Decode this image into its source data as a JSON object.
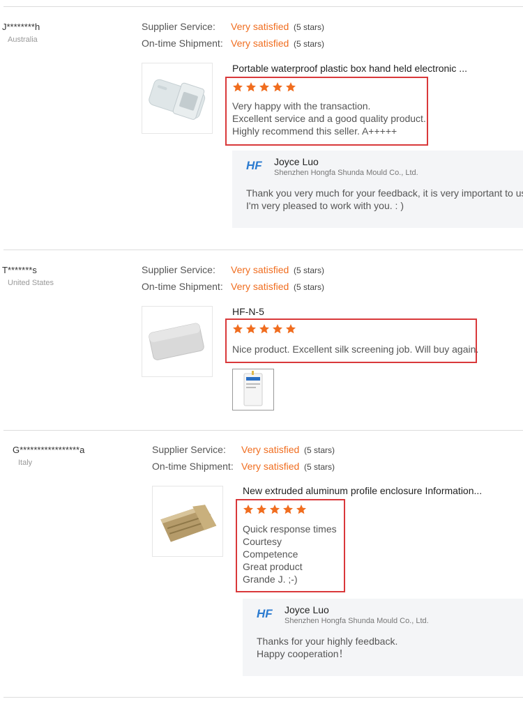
{
  "colors": {
    "accent": "#f06d1f",
    "highlight_border": "#d9383a",
    "reply_bg": "#f4f5f7"
  },
  "labels": {
    "supplier_service": "Supplier Service:",
    "on_time_shipment": "On-time Shipment:"
  },
  "reviews": [
    {
      "buyer": "J********h",
      "country": "Australia",
      "supplier_service": "Very satisfied",
      "supplier_service_stars": "(5 stars)",
      "on_time_shipment": "Very satisfied",
      "on_time_shipment_stars": "(5 stars)",
      "product_title": "Portable waterproof plastic box hand held electronic ...",
      "rating": 5,
      "review_lines": [
        "Very happy with the transaction.",
        "Excellent service and a good quality product.",
        "Highly recommend this seller. A+++++"
      ],
      "reply": {
        "name": "Joyce Luo",
        "company": "Shenzhen Hongfa Shunda Mould Co., Ltd.",
        "lines": [
          "Thank you very much for your feedback, it is very important to us.",
          "I'm very pleased to work with you. : )"
        ]
      }
    },
    {
      "buyer": "T*******s",
      "country": "United States",
      "supplier_service": "Very satisfied",
      "supplier_service_stars": "(5 stars)",
      "on_time_shipment": "Very satisfied",
      "on_time_shipment_stars": "(5 stars)",
      "product_title": "HF-N-5",
      "rating": 5,
      "review_lines": [
        "Nice product. Excellent silk screening job. Will buy again."
      ]
    },
    {
      "buyer": "G*****************a",
      "country": "Italy",
      "supplier_service": "Very satisfied",
      "supplier_service_stars": "(5 stars)",
      "on_time_shipment": "Very satisfied",
      "on_time_shipment_stars": "(5 stars)",
      "product_title": "New extruded aluminum profile enclosure Information...",
      "rating": 5,
      "review_lines": [
        "Quick response times",
        "Courtesy",
        "Competence",
        "Great product",
        "Grande J. ;-)"
      ],
      "reply": {
        "name": "Joyce Luo",
        "company": "Shenzhen Hongfa Shunda Mould Co., Ltd.",
        "lines": [
          "Thanks for your highly feedback.",
          "Happy cooperation！"
        ]
      }
    }
  ]
}
